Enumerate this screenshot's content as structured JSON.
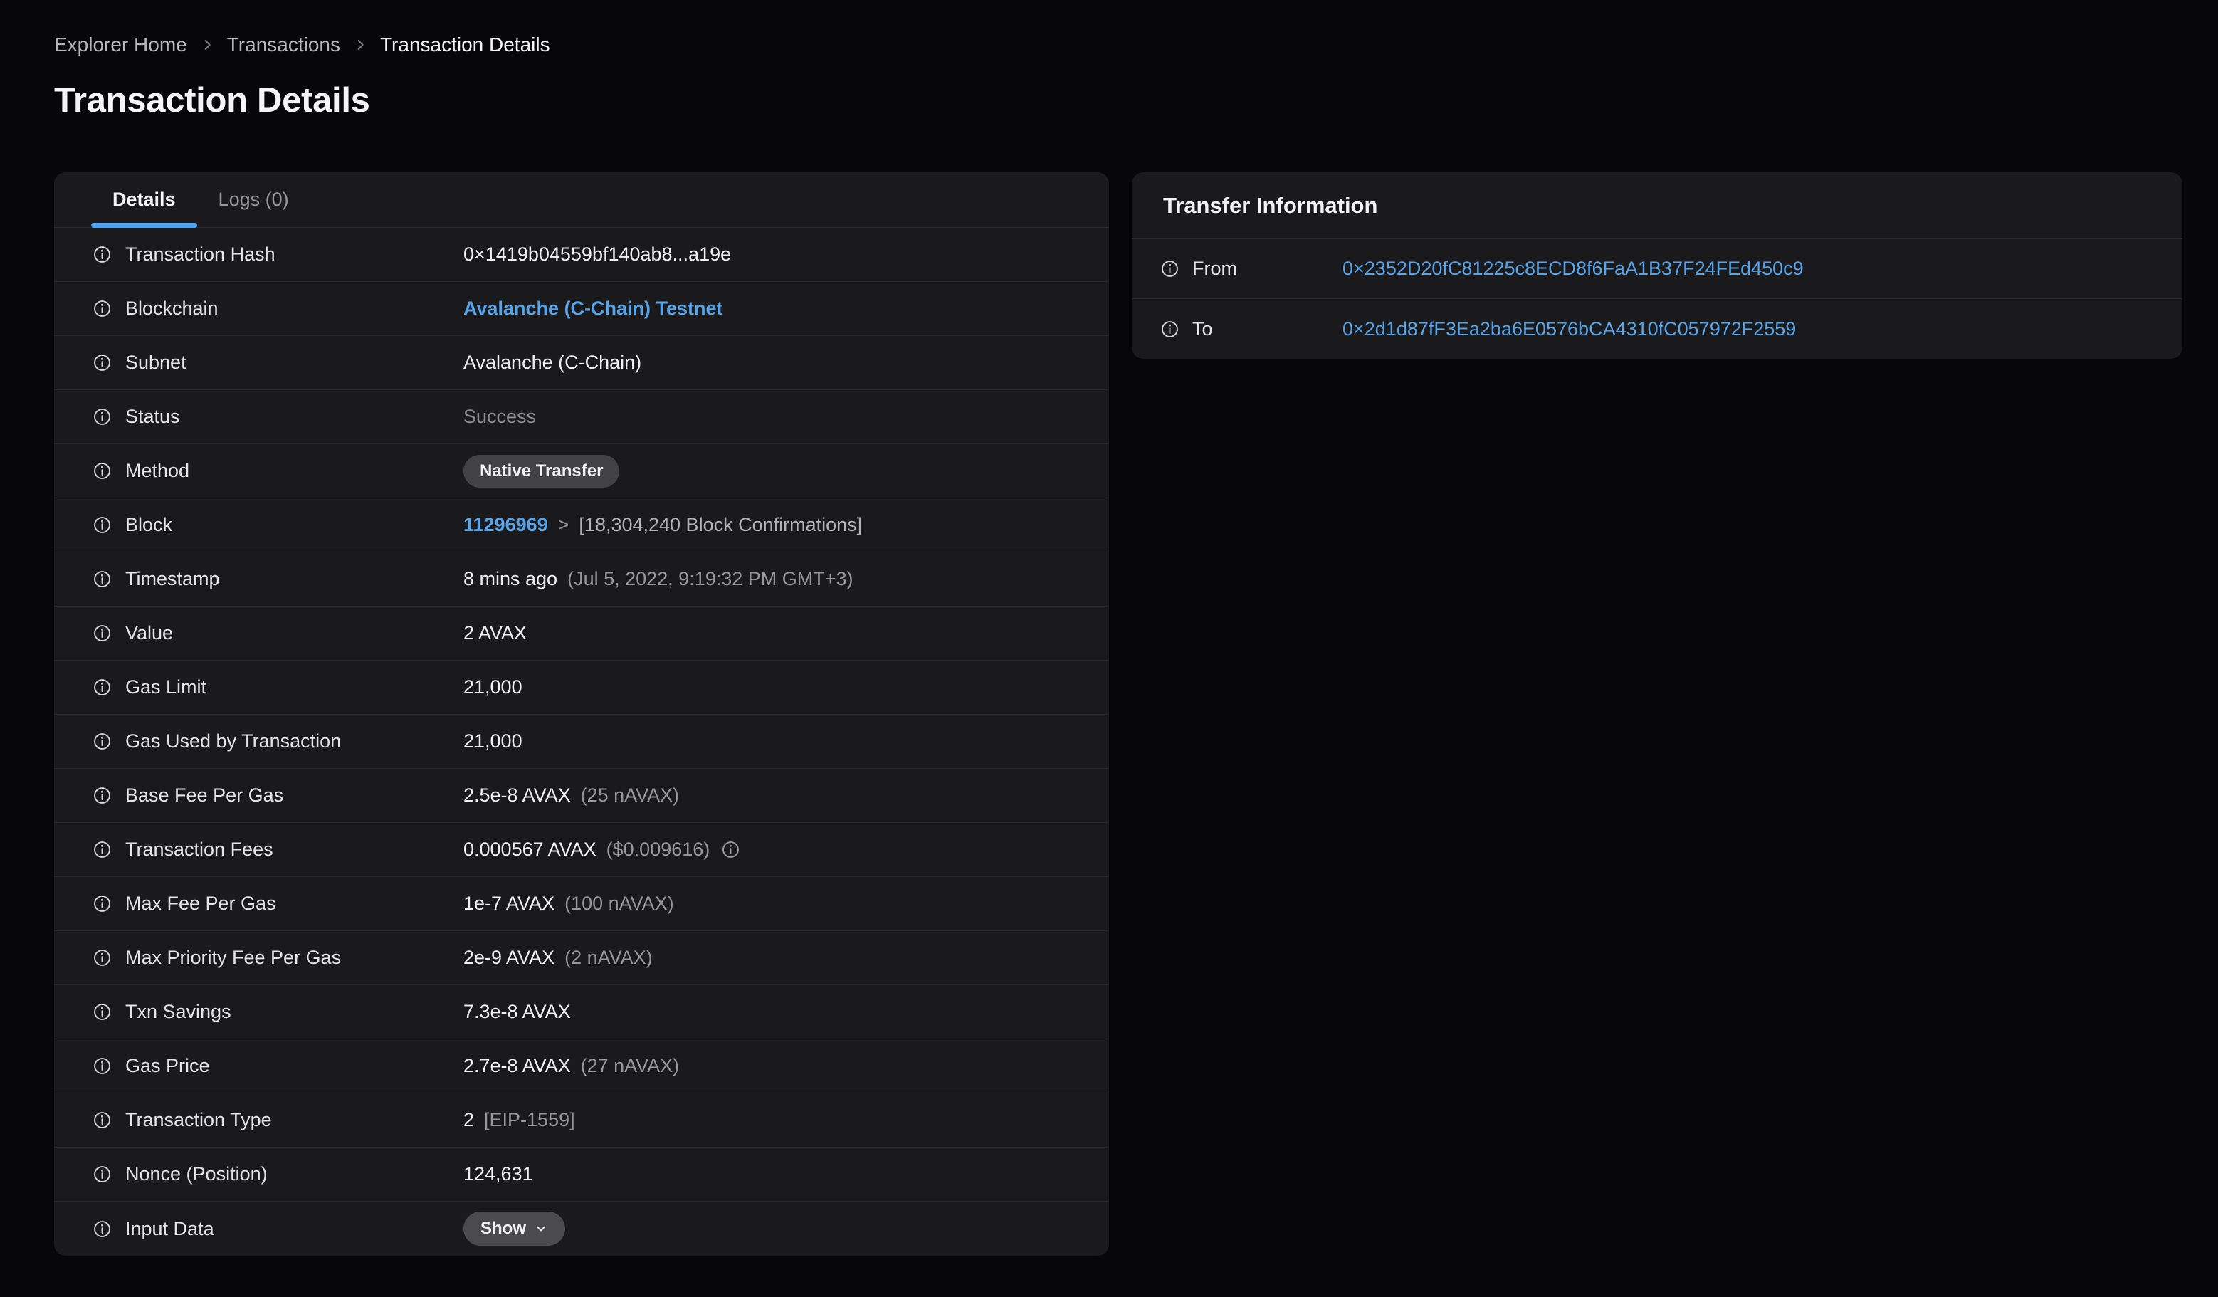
{
  "colors": {
    "page_bg": "#070709",
    "card_bg": "#1a1a1d",
    "row_border": "#28282b",
    "text_primary": "#f0f0f2",
    "text_label": "#e5e5e7",
    "text_secondary": "#98989b",
    "text_muted": "#8d8d90",
    "link_blue": "#58a4e8",
    "tab_underline_blue": "#4da3f0",
    "badge_bg": "#414146",
    "button_bg": "#4a4a4f"
  },
  "icons": {
    "info-icon": "ⓘ",
    "chevron-right-icon": "›",
    "chevron-down-icon": "⌄"
  },
  "breadcrumb": {
    "items": [
      {
        "label": "Explorer Home",
        "current": false
      },
      {
        "label": "Transactions",
        "current": false
      },
      {
        "label": "Transaction Details",
        "current": true
      }
    ]
  },
  "page_title": "Transaction Details",
  "details_card": {
    "tabs": [
      {
        "label": "Details",
        "active": true
      },
      {
        "label": "Logs (0)",
        "active": false
      }
    ],
    "rows": [
      {
        "label": "Transaction Hash",
        "type": "text",
        "value": "0×1419b04559bf140ab8...a19e"
      },
      {
        "label": "Blockchain",
        "type": "link",
        "value": "Avalanche (C-Chain) Testnet"
      },
      {
        "label": "Subnet",
        "type": "text",
        "value": "Avalanche (C-Chain)"
      },
      {
        "label": "Status",
        "type": "status",
        "value": "Success"
      },
      {
        "label": "Method",
        "type": "badge",
        "value": "Native Transfer"
      },
      {
        "label": "Block",
        "type": "block",
        "link": "11296969",
        "separator": ">",
        "suffix": "[18,304,240 Block Confirmations]"
      },
      {
        "label": "Timestamp",
        "type": "text_suffix",
        "value": "8 mins ago",
        "suffix": "(Jul 5, 2022, 9:19:32 PM GMT+3)"
      },
      {
        "label": "Value",
        "type": "text",
        "value": "2 AVAX"
      },
      {
        "label": "Gas Limit",
        "type": "text",
        "value": "21,000"
      },
      {
        "label": "Gas Used by Transaction",
        "type": "text",
        "value": "21,000"
      },
      {
        "label": "Base Fee Per Gas",
        "type": "text_suffix",
        "value": "2.5e-8 AVAX",
        "suffix": "(25 nAVAX)"
      },
      {
        "label": "Transaction Fees",
        "type": "text_suffix_info",
        "value": "0.000567 AVAX",
        "suffix": "($0.009616)"
      },
      {
        "label": "Max Fee Per Gas",
        "type": "text_suffix",
        "value": "1e-7 AVAX",
        "suffix": "(100 nAVAX)"
      },
      {
        "label": "Max Priority Fee Per Gas",
        "type": "text_suffix",
        "value": "2e-9 AVAX",
        "suffix": "(2 nAVAX)"
      },
      {
        "label": "Txn Savings",
        "type": "text",
        "value": "7.3e-8 AVAX"
      },
      {
        "label": "Gas Price",
        "type": "text_suffix",
        "value": "2.7e-8 AVAX",
        "suffix": "(27 nAVAX)"
      },
      {
        "label": "Transaction Type",
        "type": "text_suffix",
        "value": "2",
        "suffix": "[EIP-1559]"
      },
      {
        "label": "Nonce (Position)",
        "type": "text",
        "value": "124,631"
      },
      {
        "label": "Input Data",
        "type": "button",
        "value": "Show"
      }
    ]
  },
  "transfer_card": {
    "title": "Transfer Information",
    "rows": [
      {
        "label": "From",
        "type": "address",
        "value": "0×2352D20fC81225c8ECD8f6FaA1B37F24FEd450c9"
      },
      {
        "label": "To",
        "type": "address",
        "value": "0×2d1d87fF3Ea2ba6E0576bCA4310fC057972F2559"
      }
    ]
  }
}
